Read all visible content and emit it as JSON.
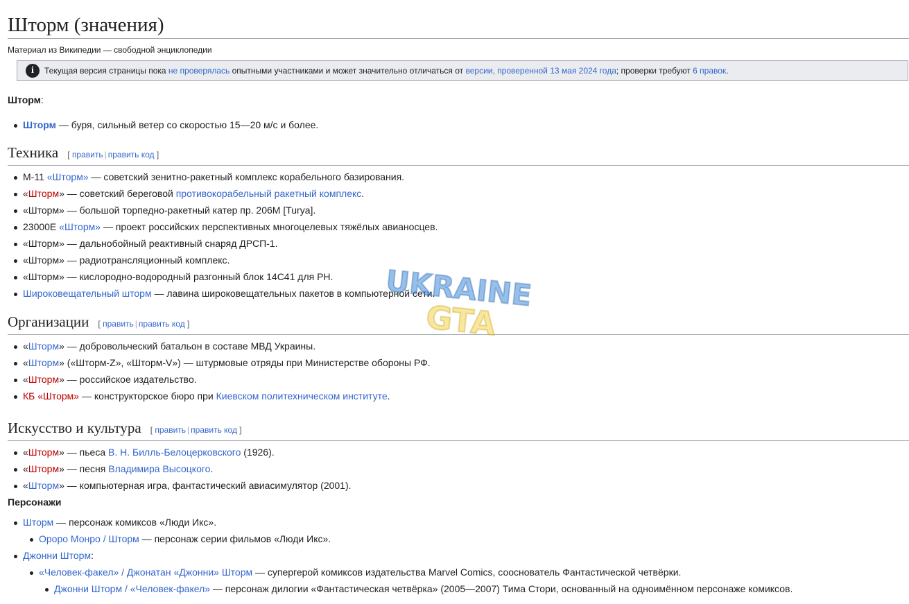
{
  "page": {
    "title": "Шторм (значения)",
    "tagline": "Материал из Википедии — свободной энциклопедии",
    "notice": {
      "t1": "Текущая версия страницы пока ",
      "link1": "не проверялась",
      "t2": " опытными участниками и может значительно отличаться от ",
      "link2": "версии, проверенной 13 мая 2024 года",
      "t3": "; проверки требуют ",
      "link3": "6 правок",
      "t4": "."
    },
    "intro": {
      "bold": "Шторм",
      "colon": ":"
    },
    "intro_item": {
      "link": "Шторм",
      "rest": " — буря, сильный ветер со скоростью 15—20 м/с и более."
    }
  },
  "edit": {
    "open": "[ ",
    "edit": "править",
    "sep": "|",
    "edit_code": "править код",
    "close": " ]"
  },
  "q": {
    "open": "«",
    "close": "»"
  },
  "tech": {
    "heading": "Техника",
    "i1": {
      "pre": "М-11 ",
      "link": "Шторм",
      "rest": " — советский зенитно-ракетный комплекс корабельного базирования."
    },
    "i2": {
      "link": "Шторм",
      "mid": " — советский береговой ",
      "link2": "противокорабельный ракетный комплекс",
      "end": "."
    },
    "i3": {
      "text": "«Шторм» — большой торпедно-ракетный катер пр. 206М [Turya]."
    },
    "i4": {
      "pre": "23000Е ",
      "link": "Шторм",
      "rest": " — проект российских перспективных многоцелевых тяжёлых авианосцев."
    },
    "i5": {
      "text": "«Шторм» — дальнобойный реактивный снаряд ДРСП-1."
    },
    "i6": {
      "text": "«Шторм» — радиотрансляционный комплекс."
    },
    "i7": {
      "text": "«Шторм» — кислородно-водородный разгонный блок 14С41 для РН."
    },
    "i8": {
      "link": "Широковещательный шторм",
      "rest": " — лавина широковещательных пакетов в компьютерной сети."
    }
  },
  "org": {
    "heading": "Организации",
    "i1": {
      "link": "Шторм",
      "rest": " — добровольческий батальон в составе МВД Украины."
    },
    "i2": {
      "link": "Шторм",
      "rest": " («Шторм-Z», «Шторм-V») — штурмовые отряды при Министерстве обороны РФ."
    },
    "i3": {
      "link": "Шторм",
      "rest": " — российское издательство."
    },
    "i4": {
      "link": "КБ «Шторм»",
      "mid": " — конструкторское бюро при ",
      "link2": "Киевском политехническом институте",
      "end": "."
    }
  },
  "art": {
    "heading": "Искусство и культура",
    "i1": {
      "link": "Шторм",
      "mid": " — пьеса ",
      "link2": "В. Н. Билль-Белоцерковского",
      "end": " (1926)."
    },
    "i2": {
      "link": "Шторм",
      "mid": " — песня ",
      "link2": "Владимира Высоцкого",
      "end": "."
    },
    "i3": {
      "link": "Шторм",
      "rest": " — компьютерная игра, фантастический авиасимулятор (2001)."
    },
    "subhead": "Персонажи",
    "c1": {
      "link": "Шторм",
      "rest": " — персонаж комиксов «Люди Икс»."
    },
    "c1a": {
      "link": "Ороро Монро / Шторм",
      "rest": " — персонаж серии фильмов «Люди Икс»."
    },
    "c2": {
      "link": "Джонни Шторм",
      "rest": ":"
    },
    "c2a": {
      "link": "«Человек-факел» / Джонатан «Джонни» Шторм",
      "rest": " — супергерой комиксов издательства Marvel Comics, сооснователь Фантастической четвёрки."
    },
    "c2b": {
      "link": "Джонни Шторм / «Человек-факел»",
      "rest": " — персонаж дилогии «Фантастическая четвёрка» (2005—2007) Тима Стори, основанный на одноимённом персонаже комиксов."
    }
  },
  "watermark": {
    "line1": "UKRAINE",
    "line2": "GTA"
  },
  "colors": {
    "link": "#3366cc",
    "redlink": "#ba0000",
    "border": "#a2a9b1",
    "notice_bg": "#eaecf0"
  }
}
